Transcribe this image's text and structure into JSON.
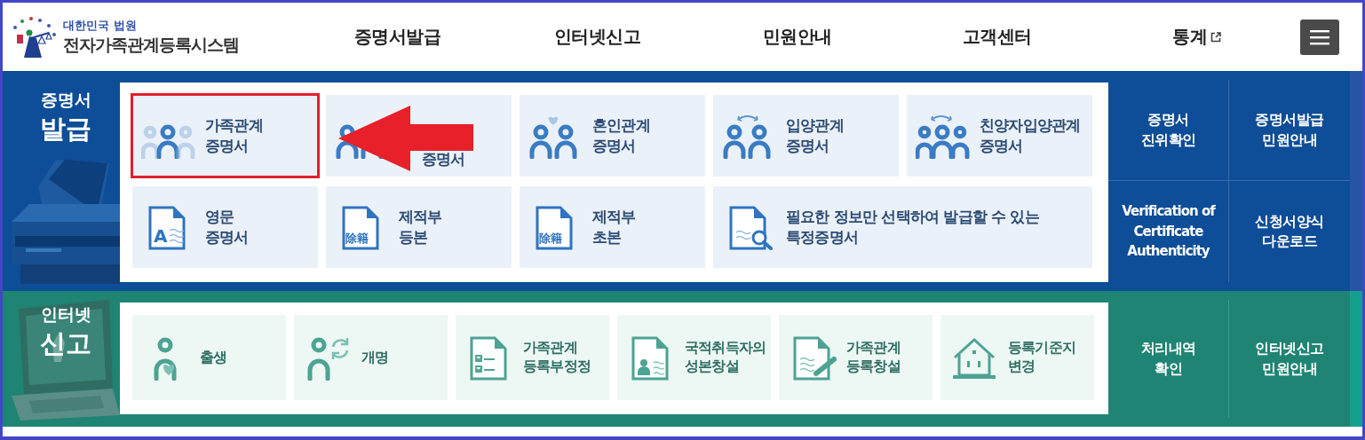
{
  "header": {
    "org": "대한민국 법원",
    "system": "전자가족관계등록시스템",
    "nav": [
      {
        "label": "증명서발급",
        "external": false
      },
      {
        "label": "인터넷신고",
        "external": false
      },
      {
        "label": "민원안내",
        "external": false
      },
      {
        "label": "고객센터",
        "external": false
      },
      {
        "label": "통계",
        "external": true
      }
    ]
  },
  "issuance": {
    "title_small": "증명서",
    "title_large": "발급",
    "tiles": [
      {
        "label": "가족관계\n증명서",
        "highlighted": true
      },
      {
        "label": "증명서",
        "highlighted": false
      },
      {
        "label": "혼인관계\n증명서",
        "highlighted": false
      },
      {
        "label": "입양관계\n증명서",
        "highlighted": false
      },
      {
        "label": "친양자입양관계\n증명서",
        "highlighted": false
      },
      {
        "label": "영문\n증명서",
        "icon_text": "A",
        "highlighted": false
      },
      {
        "label": "제적부\n등본",
        "icon_text": "除籍",
        "highlighted": false
      },
      {
        "label": "제적부\n초본",
        "icon_text": "除籍",
        "highlighted": false
      },
      {
        "label": "필요한 정보만 선택하여 발급할 수 있는\n특정증명서",
        "highlighted": false,
        "wide": true
      }
    ],
    "links": [
      "증명서\n진위확인",
      "증명서발급\n민원안내",
      "Verification of\nCertificate\nAuthenticity",
      "신청서양식\n다운로드"
    ]
  },
  "report": {
    "title_small": "인터넷",
    "title_large": "신고",
    "tiles": [
      {
        "label": "출생"
      },
      {
        "label": "개명"
      },
      {
        "label": "가족관계\n등록부정정"
      },
      {
        "label": "국적취득자의\n성본창설"
      },
      {
        "label": "가족관계\n등록창설"
      },
      {
        "label": "등록기준지\n변경"
      }
    ],
    "links": [
      "처리내역\n확인",
      "인터넷신고\n민원안내"
    ]
  },
  "annotations": [
    {
      "kind": "arrow"
    }
  ]
}
